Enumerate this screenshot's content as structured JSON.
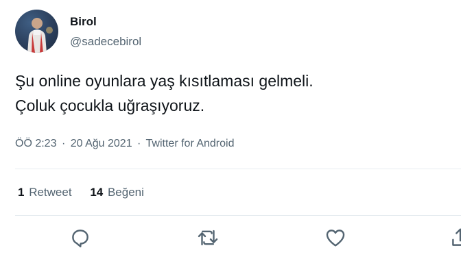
{
  "tweet": {
    "author": {
      "display_name": "Birol",
      "handle": "@sadecebirol",
      "avatar_icon": "profile-avatar"
    },
    "text_lines": [
      "Şu online oyunlara yaş kısıtlaması gelmeli.",
      "Çoluk çocukla uğraşıyoruz."
    ],
    "meta": {
      "time": "ÖÖ 2:23",
      "separator": "·",
      "date": "20 Ağu 2021",
      "source": "Twitter for Android"
    },
    "stats": {
      "retweets_count": "1",
      "retweets_label": "Retweet",
      "likes_count": "14",
      "likes_label": "Beğeni"
    },
    "actions": [
      {
        "icon": "reply-icon"
      },
      {
        "icon": "retweet-icon"
      },
      {
        "icon": "like-icon"
      },
      {
        "icon": "share-icon"
      }
    ]
  },
  "colors": {
    "text_primary": "#0f1419",
    "text_secondary": "#536471",
    "divider": "#e6ecf0"
  }
}
